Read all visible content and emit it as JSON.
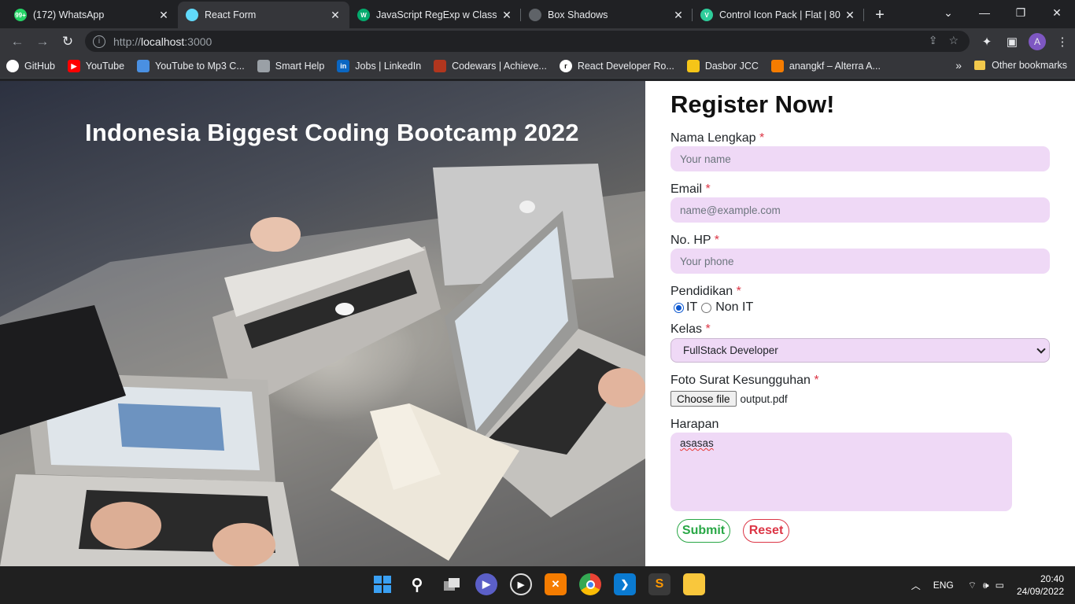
{
  "browser": {
    "tabs": [
      {
        "title": "(172) WhatsApp",
        "favicon": "whatsapp-icon",
        "favicon_text": "99+",
        "color": "#25d366",
        "active": false
      },
      {
        "title": "React Form",
        "favicon": "react-icon",
        "favicon_text": "",
        "color": "#61dafb",
        "active": true
      },
      {
        "title": "JavaScript RegExp w Class",
        "favicon": "w3schools-icon",
        "favicon_text": "W",
        "color": "#04aa6d",
        "active": false
      },
      {
        "title": "Box Shadows",
        "favicon": "shield-icon",
        "favicon_text": "",
        "color": "#5f6368",
        "active": false
      },
      {
        "title": "Control Icon Pack | Flat | 80 ...",
        "favicon": "v-icon",
        "favicon_text": "V",
        "color": "#2ecc9a",
        "active": false
      }
    ],
    "url_scheme": "http://",
    "url_host": "localhost",
    "url_rest": ":3000",
    "profile_initial": "A",
    "bookmarks": [
      {
        "label": "GitHub",
        "icon": "github-icon",
        "color": "#ffffff",
        "text": ""
      },
      {
        "label": "YouTube",
        "icon": "youtube-icon",
        "color": "#ff0000",
        "text": "▶"
      },
      {
        "label": "YouTube to Mp3 C...",
        "icon": "cloud-download-icon",
        "color": "#4a90e2",
        "text": ""
      },
      {
        "label": "Smart Help",
        "icon": "globe-icon",
        "color": "#9aa0a6",
        "text": ""
      },
      {
        "label": "Jobs | LinkedIn",
        "icon": "linkedin-icon",
        "color": "#0a66c2",
        "text": "in"
      },
      {
        "label": "Codewars | Achieve...",
        "icon": "codewars-icon",
        "color": "#b1361e",
        "text": ""
      },
      {
        "label": "React Developer Ro...",
        "icon": "roadmap-icon",
        "color": "#ffffff",
        "text": "r"
      },
      {
        "label": "Dasbor JCC",
        "icon": "jcc-icon",
        "color": "#f5c518",
        "text": ""
      },
      {
        "label": "anangkf – Alterra A...",
        "icon": "alterra-icon",
        "color": "#f57c00",
        "text": ""
      }
    ],
    "other_bookmarks": "Other bookmarks"
  },
  "hero": {
    "title": "Indonesia Biggest Coding Bootcamp 2022"
  },
  "form": {
    "title": "Register Now!",
    "required_mark": "*",
    "name": {
      "label": "Nama Lengkap",
      "placeholder": "Your name"
    },
    "email": {
      "label": "Email",
      "placeholder": "name@example.com"
    },
    "phone": {
      "label": "No. HP",
      "placeholder": "Your phone"
    },
    "education": {
      "label": "Pendidikan",
      "options": [
        "IT",
        "Non IT"
      ],
      "selected": "IT"
    },
    "class": {
      "label": "Kelas",
      "value": "FullStack Developer"
    },
    "file": {
      "label": "Foto Surat Kesungguhan",
      "button": "Choose file",
      "filename": "output.pdf"
    },
    "hope": {
      "label": "Harapan",
      "value": "asasas"
    },
    "submit": "Submit",
    "reset": "Reset"
  },
  "taskbar": {
    "language": "ENG",
    "time": "20:40",
    "date": "24/09/2022"
  }
}
